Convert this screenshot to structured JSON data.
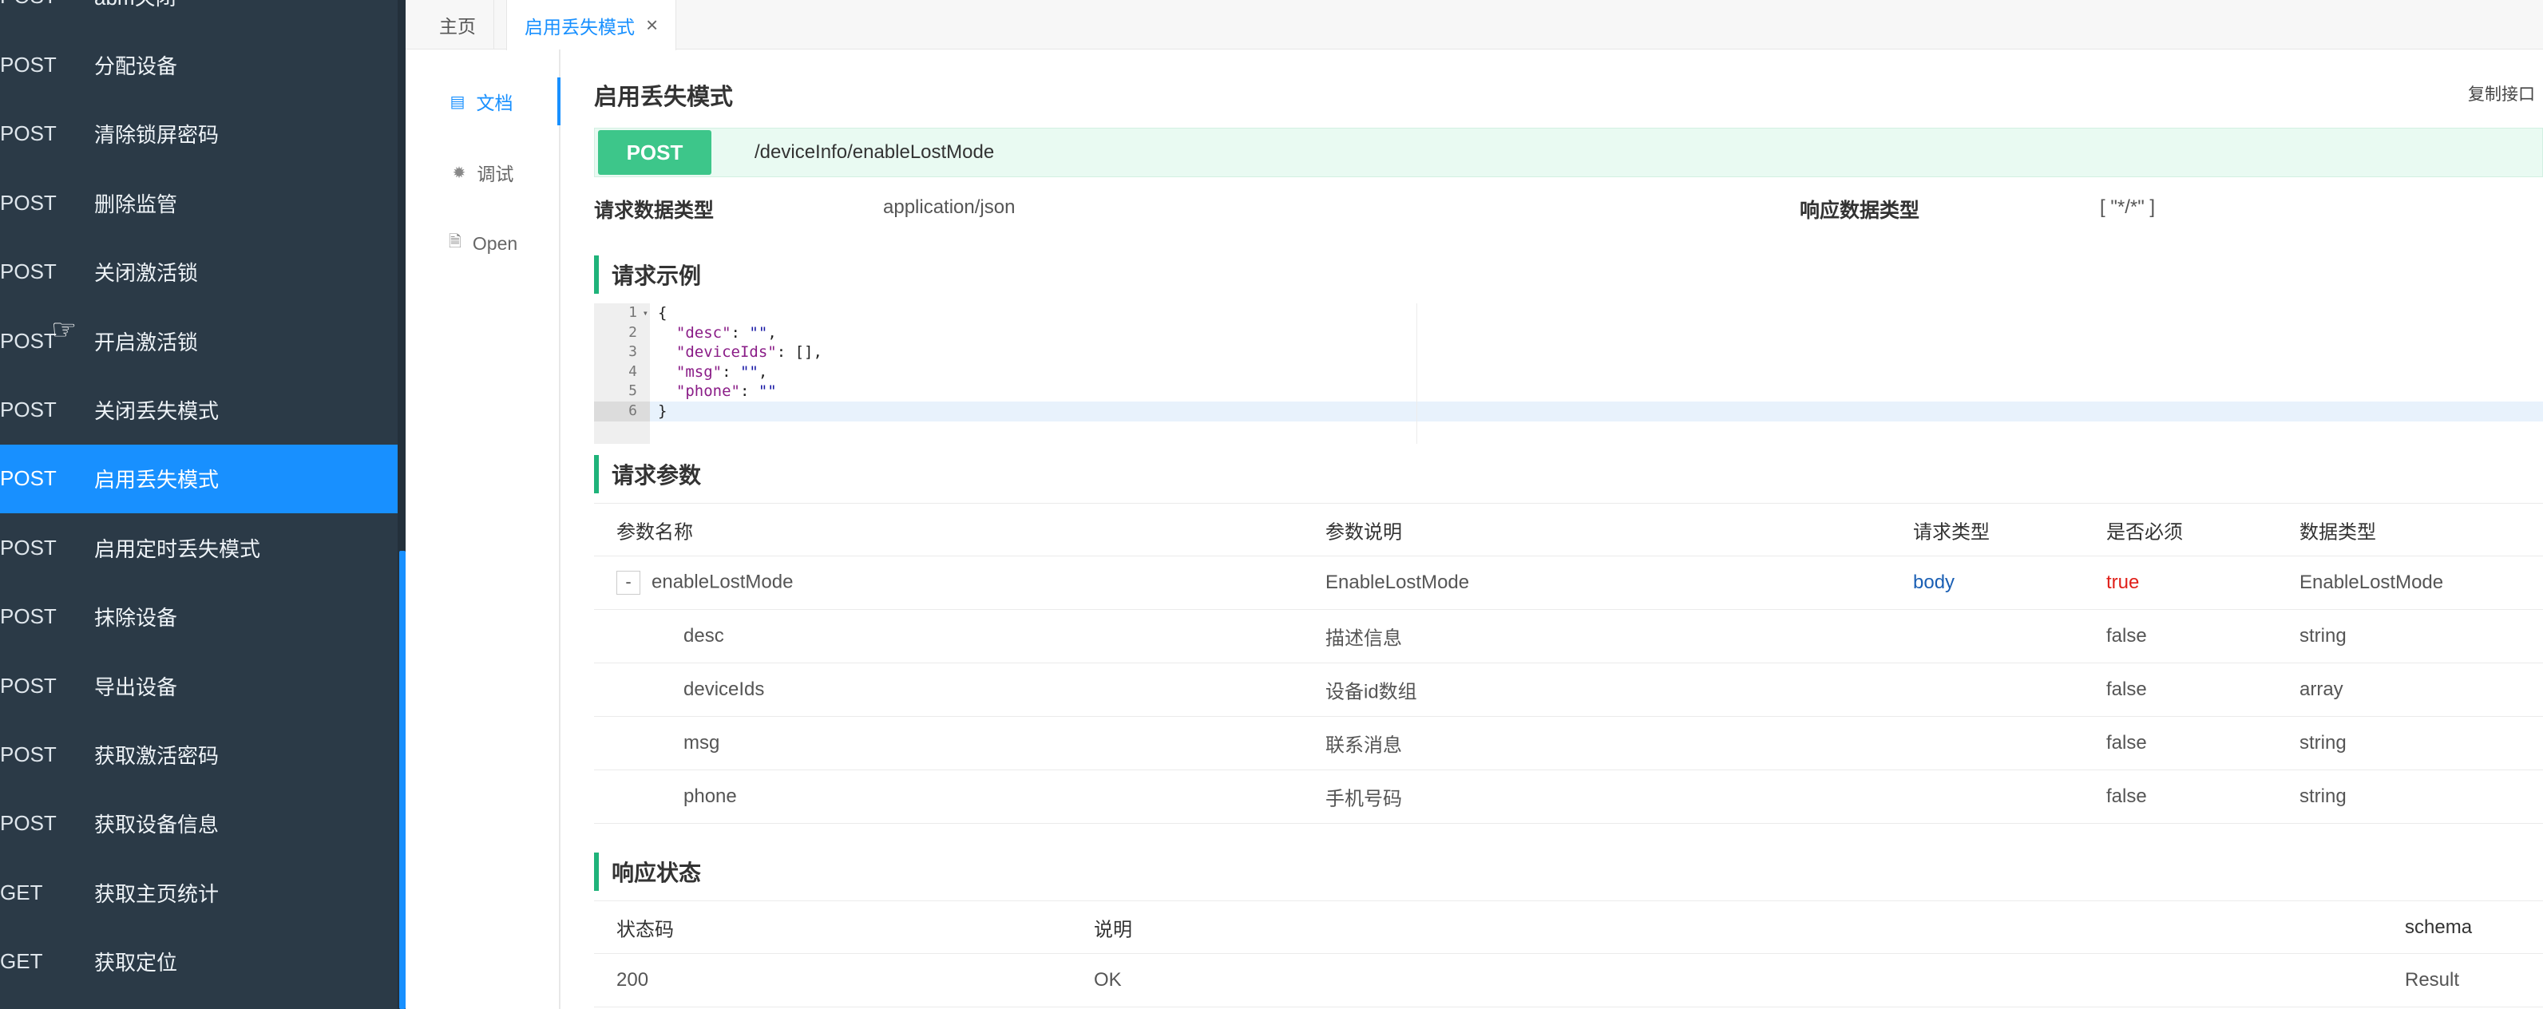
{
  "sidebar": {
    "items": [
      {
        "method": "POST",
        "name": "abm关闭"
      },
      {
        "method": "POST",
        "name": "分配设备"
      },
      {
        "method": "POST",
        "name": "清除锁屏密码"
      },
      {
        "method": "POST",
        "name": "删除监管"
      },
      {
        "method": "POST",
        "name": "关闭激活锁"
      },
      {
        "method": "POST",
        "name": "开启激活锁"
      },
      {
        "method": "POST",
        "name": "关闭丢失模式"
      },
      {
        "method": "POST",
        "name": "启用丢失模式"
      },
      {
        "method": "POST",
        "name": "启用定时丢失模式"
      },
      {
        "method": "POST",
        "name": "抹除设备"
      },
      {
        "method": "POST",
        "name": "导出设备"
      },
      {
        "method": "POST",
        "name": "获取激活密码"
      },
      {
        "method": "POST",
        "name": "获取设备信息"
      },
      {
        "method": "GET",
        "name": "获取主页统计"
      },
      {
        "method": "GET",
        "name": "获取定位"
      }
    ]
  },
  "tabs": {
    "home": "主页",
    "active": "启用丢失模式",
    "close_glyph": "×"
  },
  "doc_nav": {
    "doc": "文档",
    "debug": "调试",
    "open": "Open"
  },
  "main": {
    "title": "启用丢失模式",
    "copy_link": "复制接口",
    "method": "POST",
    "path": "/deviceInfo/enableLostMode",
    "request_type_label": "请求数据类型",
    "request_type_value": "application/json",
    "response_type_label": "响应数据类型",
    "response_type_value": "[ \"*/*\" ]"
  },
  "request_example": {
    "heading": "请求示例",
    "line_numbers": [
      "1",
      "2",
      "3",
      "4",
      "5",
      "6"
    ]
  },
  "request_params": {
    "heading": "请求参数",
    "headers": [
      "参数名称",
      "参数说明",
      "请求类型",
      "是否必须",
      "数据类型"
    ],
    "expand_glyph": "-",
    "rows": [
      {
        "name": "enableLostMode",
        "desc": "EnableLostMode",
        "in": "body",
        "required": "true",
        "type": "EnableLostMode"
      },
      {
        "name": "desc",
        "desc": "描述信息",
        "in": "",
        "required": "false",
        "type": "string"
      },
      {
        "name": "deviceIds",
        "desc": "设备id数组",
        "in": "",
        "required": "false",
        "type": "array"
      },
      {
        "name": "msg",
        "desc": "联系消息",
        "in": "",
        "required": "false",
        "type": "string"
      },
      {
        "name": "phone",
        "desc": "手机号码",
        "in": "",
        "required": "false",
        "type": "string"
      }
    ]
  },
  "response_status": {
    "heading": "响应状态",
    "headers": [
      "状态码",
      "说明",
      "schema"
    ],
    "rows": [
      {
        "code": "200",
        "desc": "OK",
        "schema": "Result"
      }
    ]
  },
  "colors": {
    "sidebar_bg": "#2b3a47",
    "accent": "#1890ff",
    "post_green": "#3dc68a",
    "required_red": "#e0201a"
  }
}
